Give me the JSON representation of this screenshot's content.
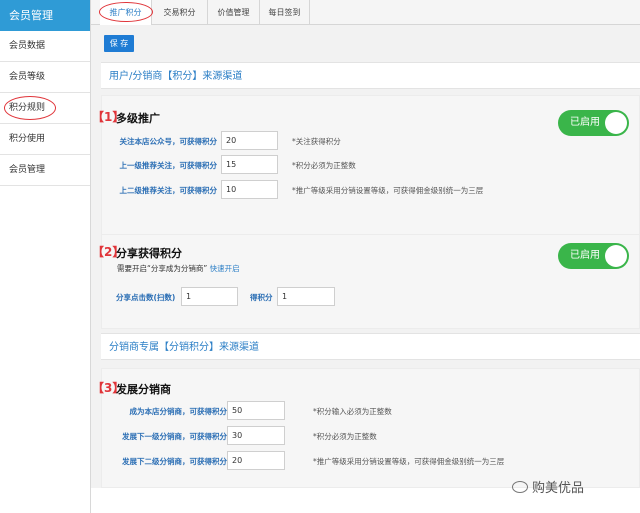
{
  "sidebar": {
    "header": "会员管理",
    "items": [
      {
        "label": "会员数据"
      },
      {
        "label": "会员等级"
      },
      {
        "label": "积分规则"
      },
      {
        "label": "积分使用"
      },
      {
        "label": "会员管理"
      }
    ]
  },
  "tabs": [
    {
      "label": "推广积分"
    },
    {
      "label": "交易积分"
    },
    {
      "label": "价值管理"
    },
    {
      "label": "每日签到"
    }
  ],
  "toolbar": {
    "save_label": "保 存"
  },
  "sections": {
    "user_bar": "用户/分销商【积分】来源渠道",
    "dist_bar": "分销商专属【分销积分】来源渠道"
  },
  "s1": {
    "num": "【1】",
    "title": "多级推广",
    "toggle": "已启用",
    "rows": [
      {
        "label": "关注本店公众号，可获得积分",
        "value": "20",
        "hint": "*关注获得积分"
      },
      {
        "label": "上一级推荐关注，可获得积分",
        "value": "15",
        "hint": "*积分必须为正整数"
      },
      {
        "label": "上二级推荐关注，可获得积分",
        "value": "10",
        "hint": "*推广等级采用分销设置等级，可获得佣金级别统一为三层"
      }
    ]
  },
  "s2": {
    "num": "【2】",
    "title": "分享获得积分",
    "toggle": "已启用",
    "note": "需要开启“分享成为分销商”",
    "note_link": "快速开启",
    "clicks_label": "分享点击数(扫数)",
    "clicks_value": "1",
    "points_label": "得积分",
    "points_value": "1"
  },
  "s3": {
    "num": "【3】",
    "title": "发展分销商",
    "rows": [
      {
        "label": "成为本店分销商，可获得积分",
        "value": "50",
        "hint": "*积分输入必须为正整数"
      },
      {
        "label": "发展下一级分销商，可获得积分",
        "value": "30",
        "hint": "*积分必须为正整数"
      },
      {
        "label": "发展下二级分销商，可获得积分",
        "value": "20",
        "hint": "*推广等级采用分销设置等级，可获得佣金级别统一为三层"
      }
    ]
  },
  "watermark": "购美优品",
  "colors": {
    "accent": "#2f9bd6",
    "toggle_on": "#3ab54a",
    "highlight": "#e0353a"
  }
}
